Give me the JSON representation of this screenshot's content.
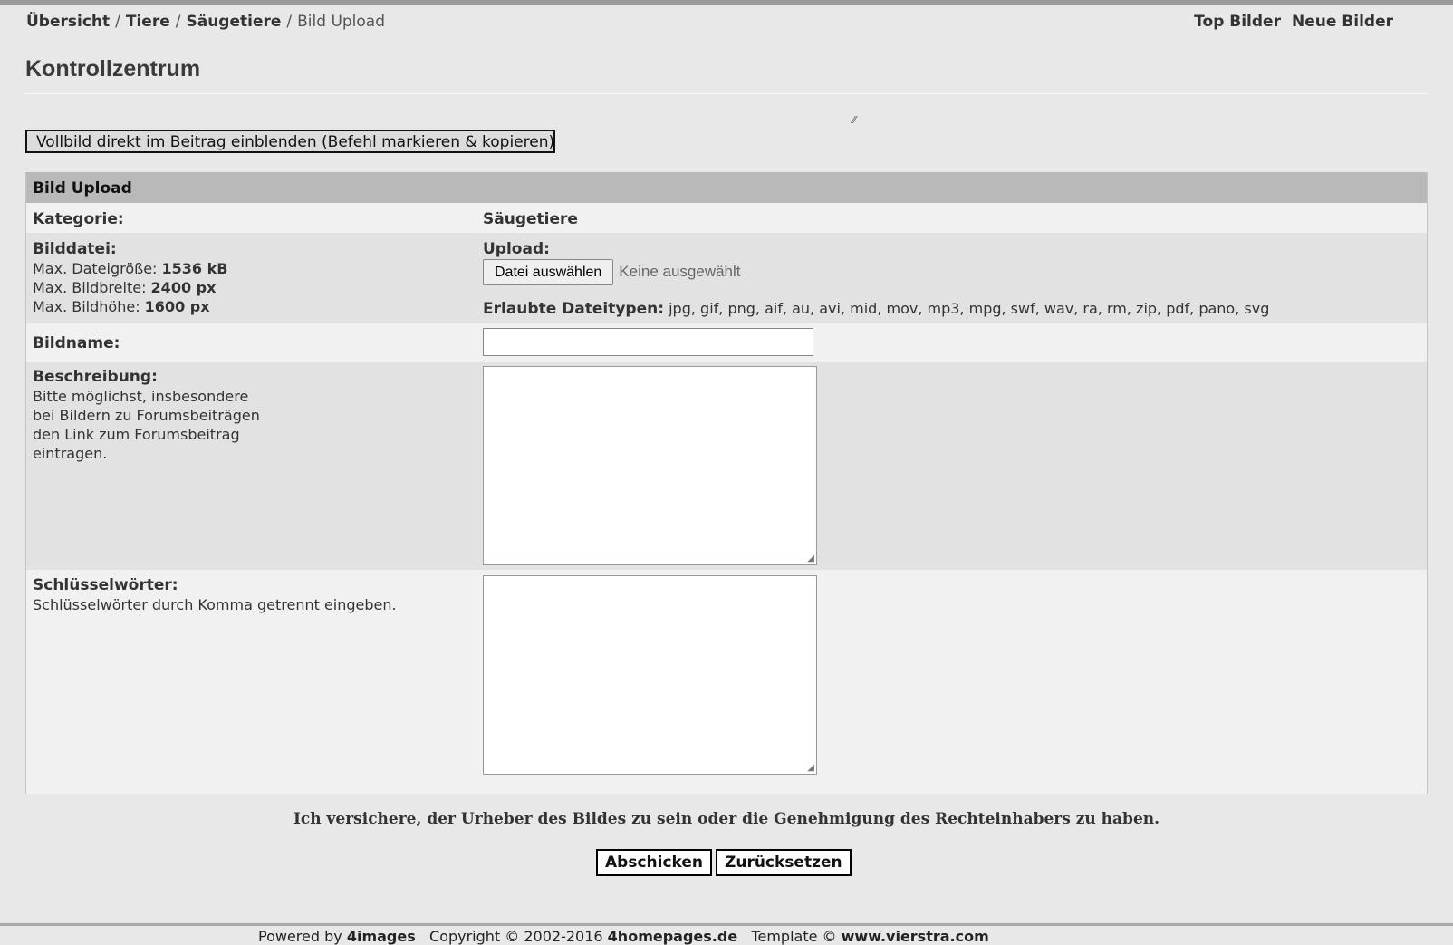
{
  "breadcrumb": {
    "items": [
      "Übersicht",
      "Tiere",
      "Säugetiere"
    ],
    "current": "Bild Upload"
  },
  "top_links": [
    "Top Bilder",
    "Neue Bilder"
  ],
  "page_title": "Kontrollzentrum",
  "fullscreen_button": "Vollbild direkt im Beitrag einblenden (Befehl markieren & kopieren)",
  "panel": {
    "title": "Bild Upload",
    "category": {
      "label": "Kategorie:",
      "value": "Säugetiere"
    },
    "image_file": {
      "label": "Bilddatei:",
      "max_size_label": "Max. Dateigröße:",
      "max_size": "1536 kB",
      "max_width_label": "Max. Bildbreite:",
      "max_width": "2400 px",
      "max_height_label": "Max. Bildhöhe:",
      "max_height": "1600 px",
      "upload_label": "Upload:",
      "choose_button": "Datei auswählen",
      "no_file": "Keine ausgewählt",
      "allowed_label": "Erlaubte Dateitypen:",
      "allowed_types": "jpg, gif, png, aif, au, avi, mid, mov, mp3, mpg, swf, wav, ra, rm, zip, pdf, pano, svg"
    },
    "image_name": {
      "label": "Bildname:",
      "value": ""
    },
    "description": {
      "label": "Beschreibung:",
      "help_lines": [
        "Bitte möglichst, insbesondere",
        "bei Bildern zu Forumsbeiträgen",
        "den Link zum Forumsbeitrag",
        "eintragen."
      ],
      "value": ""
    },
    "keywords": {
      "label": "Schlüsselwörter:",
      "help": "Schlüsselwörter durch Komma getrennt eingeben.",
      "value": ""
    }
  },
  "assurance": "Ich versichere, der Urheber des Bildes zu sein oder die Genehmigung des Rechteinhabers zu haben.",
  "buttons": {
    "submit": "Abschicken",
    "reset": "Zurücksetzen"
  },
  "footer": {
    "powered_by": "Powered by",
    "engine": "4images",
    "copyright": "Copyright © 2002-2016",
    "company": "4homepages.de",
    "template": "Template ©",
    "template_site": "www.vierstra.com"
  }
}
